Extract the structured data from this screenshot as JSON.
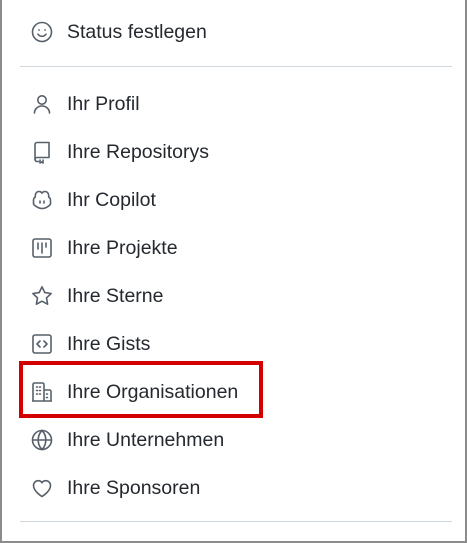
{
  "menu": {
    "status_item": {
      "label": "Status festlegen",
      "icon": "smiley-icon"
    },
    "items": [
      {
        "label": "Ihr Profil",
        "icon": "person-icon"
      },
      {
        "label": "Ihre Repositorys",
        "icon": "repo-icon"
      },
      {
        "label": "Ihr Copilot",
        "icon": "copilot-icon"
      },
      {
        "label": "Ihre Projekte",
        "icon": "project-icon"
      },
      {
        "label": "Ihre Sterne",
        "icon": "star-icon"
      },
      {
        "label": "Ihre Gists",
        "icon": "code-square-icon"
      },
      {
        "label": "Ihre Organisationen",
        "icon": "organization-icon",
        "highlighted": true
      },
      {
        "label": "Ihre Unternehmen",
        "icon": "globe-icon"
      },
      {
        "label": "Ihre Sponsoren",
        "icon": "heart-icon"
      }
    ]
  },
  "colors": {
    "text": "#24292f",
    "icon": "#57606a",
    "divider": "#d0d7de",
    "highlight_border": "#d40000",
    "frame_border": "#8c8c8c"
  }
}
